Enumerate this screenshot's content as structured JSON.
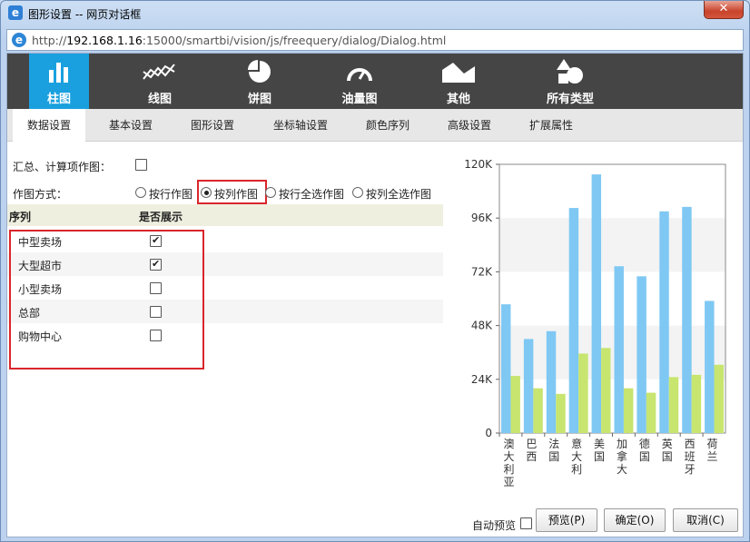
{
  "window": {
    "title": "图形设置 -- 网页对话框",
    "url_prefix": "http://",
    "url_host": "192.168.1.16",
    "url_rest": ":15000/smartbi/vision/js/freequery/dialog/Dialog.html",
    "close_icon": "close-icon",
    "ie_icon": "ie-icon"
  },
  "chart_types": [
    {
      "label": "柱图",
      "icon": "bar-chart-icon",
      "active": true
    },
    {
      "label": "线图",
      "icon": "line-chart-icon",
      "active": false
    },
    {
      "label": "饼图",
      "icon": "pie-chart-icon",
      "active": false
    },
    {
      "label": "油量图",
      "icon": "gauge-icon",
      "active": false
    },
    {
      "label": "其他",
      "icon": "area-chart-icon",
      "active": false
    },
    {
      "label": "所有类型",
      "icon": "shapes-icon",
      "active": false
    }
  ],
  "sub_tabs": [
    {
      "label": "数据设置",
      "active": true
    },
    {
      "label": "基本设置",
      "active": false
    },
    {
      "label": "图形设置",
      "active": false
    },
    {
      "label": "坐标轴设置",
      "active": false
    },
    {
      "label": "颜色序列",
      "active": false
    },
    {
      "label": "高级设置",
      "active": false
    },
    {
      "label": "扩展属性",
      "active": false
    }
  ],
  "form": {
    "summary_label": "汇总、计算项作图：",
    "summary_checked": false,
    "mode_label": "作图方式：",
    "mode_options": [
      {
        "label": "按行作图",
        "checked": false
      },
      {
        "label": "按列作图",
        "checked": true
      },
      {
        "label": "按行全选作图",
        "checked": false
      },
      {
        "label": "按列全选作图",
        "checked": false
      }
    ]
  },
  "series_table": {
    "headers": [
      "序列",
      "是否展示"
    ],
    "rows": [
      {
        "name": "中型卖场",
        "show": true
      },
      {
        "name": "大型超市",
        "show": true
      },
      {
        "name": "小型卖场",
        "show": false
      },
      {
        "name": "总部",
        "show": false
      },
      {
        "name": "购物中心",
        "show": false
      }
    ]
  },
  "chart_data": {
    "type": "bar",
    "categories": [
      "澳大利亚",
      "巴西",
      "法国",
      "意大利",
      "美国",
      "加拿大",
      "德国",
      "英国",
      "西班牙",
      "荷兰"
    ],
    "series": [
      {
        "values": [
          57500,
          42000,
          45500,
          100500,
          115500,
          74500,
          70000,
          99000,
          101000,
          59000
        ],
        "color": "#7fc8f3"
      },
      {
        "values": [
          25500,
          20000,
          17500,
          35500,
          38000,
          20000,
          18000,
          25000,
          26000,
          30500
        ],
        "color": "#c7e56f"
      }
    ],
    "y_ticks": [
      "0",
      "24K",
      "48K",
      "72K",
      "96K",
      "120K"
    ],
    "ylim": [
      0,
      120000
    ],
    "grid": "alternating bands"
  },
  "bottom": {
    "autopreview_label": "自动预览",
    "autopreview_checked": false,
    "preview_label": "预览(P)",
    "ok_label": "确定(O)",
    "cancel_label": "取消(C)"
  }
}
